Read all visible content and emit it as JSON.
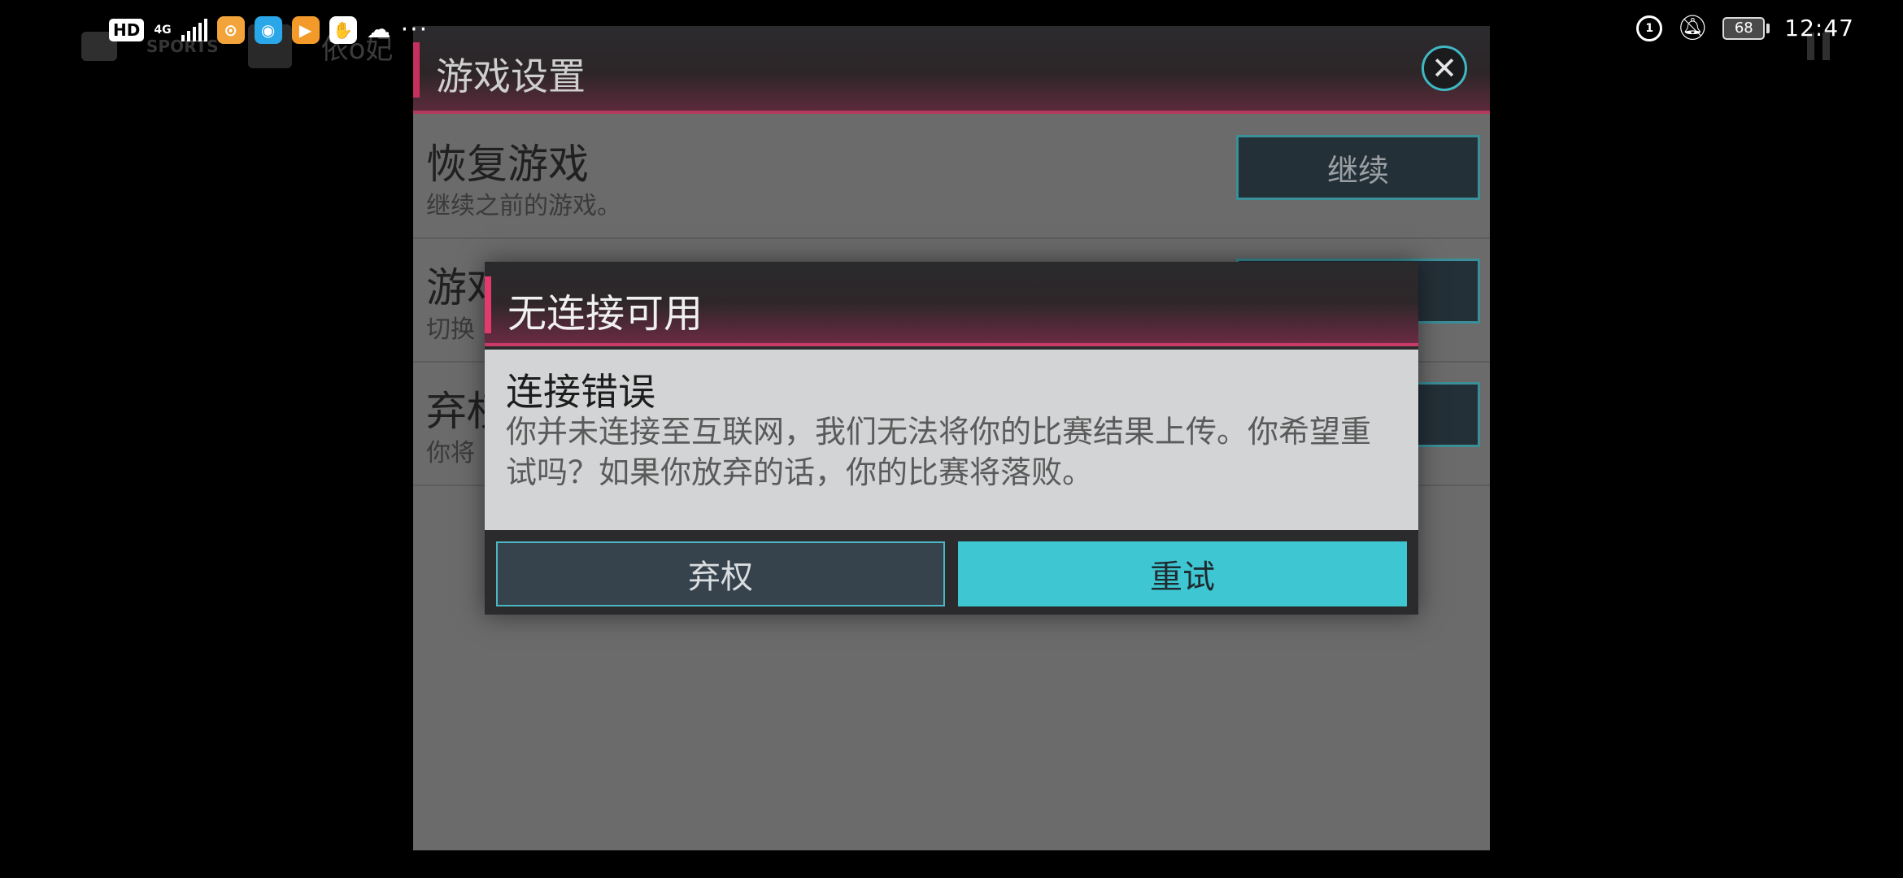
{
  "status_bar": {
    "hd": "HD",
    "network": "4G",
    "battery": "68",
    "time": "12:47"
  },
  "background": {
    "logo": "SPORTS",
    "nickname": "依o妃"
  },
  "settings": {
    "title": "游戏设置",
    "close_icon": "close-icon",
    "rows": [
      {
        "title": "恢复游戏",
        "desc": "继续之前的游戏。",
        "action": "继续"
      },
      {
        "title": "游戏",
        "desc": "切换",
        "action": ""
      },
      {
        "title": "弃权",
        "desc": "你将",
        "action": ""
      }
    ]
  },
  "dialog": {
    "title": "无连接可用",
    "heading": "连接错误",
    "message": "你并未连接至互联网，我们无法将你的比赛结果上传。你希望重试吗？如果你放弃的话，你的比赛将落败。",
    "forfeit_label": "弃权",
    "retry_label": "重试"
  },
  "colors": {
    "accent_pink": "#c83b66",
    "retry_cyan": "#3ec7d2",
    "panel_bg": "#6b6b6b"
  }
}
